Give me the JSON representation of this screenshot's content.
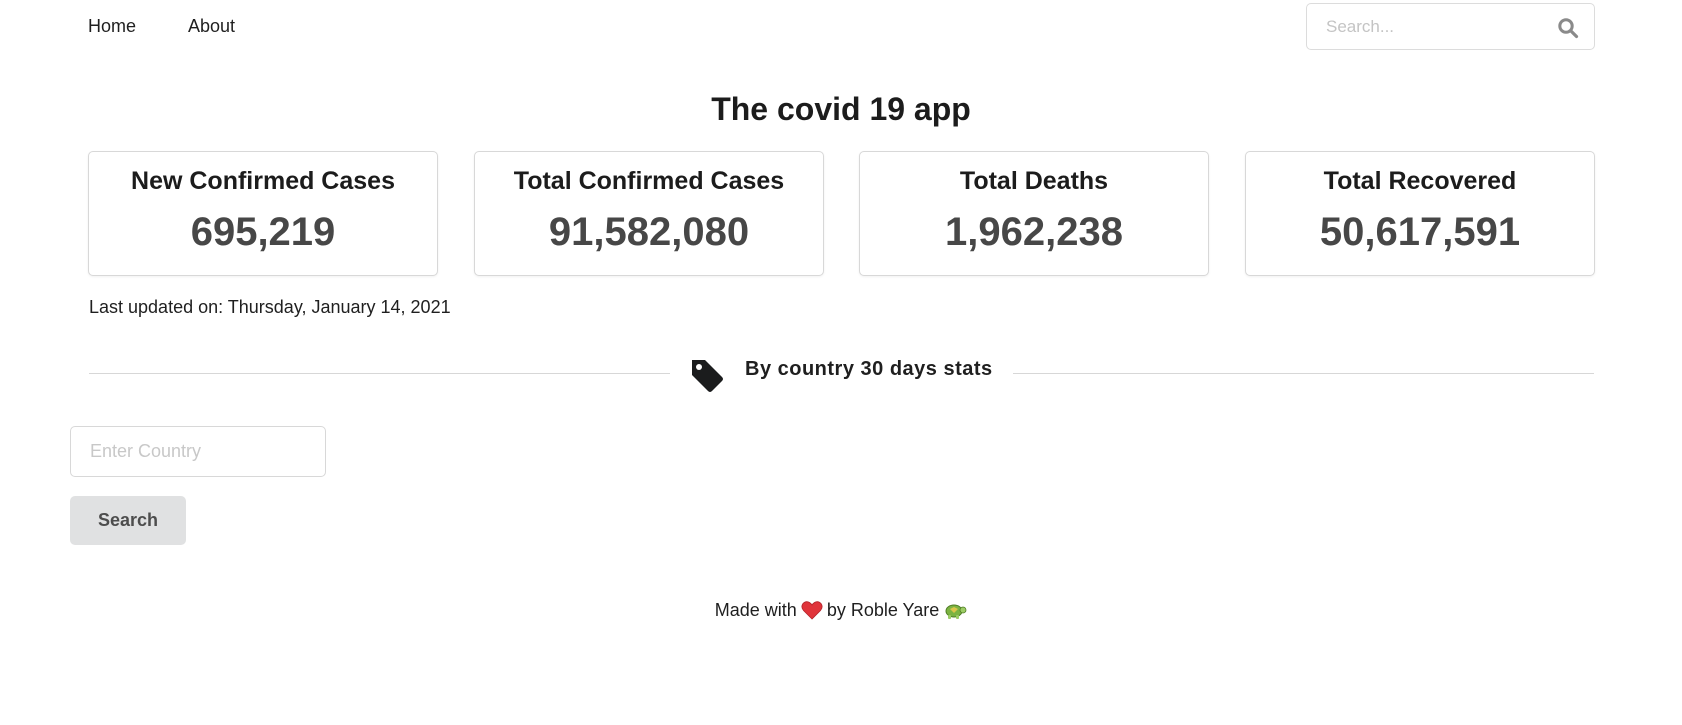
{
  "nav": {
    "home_label": "Home",
    "about_label": "About",
    "search_placeholder": "Search...",
    "search_icon": "search-icon"
  },
  "page": {
    "title": "The covid 19 app"
  },
  "stats": [
    {
      "label": "New Confirmed Cases",
      "value": "695,219"
    },
    {
      "label": "Total Confirmed Cases",
      "value": "91,582,080"
    },
    {
      "label": "Total Deaths",
      "value": "1,962,238"
    },
    {
      "label": "Total Recovered",
      "value": "50,617,591"
    }
  ],
  "last_updated": "Last updated on: Thursday, January 14, 2021",
  "section_divider": {
    "icon": "tag-icon",
    "text": "By country 30 days stats"
  },
  "country_search": {
    "placeholder": "Enter Country",
    "button_label": "Search"
  },
  "footer": {
    "made_with": "Made with",
    "by_text": "by Roble Yare",
    "heart_icon": "heart-icon",
    "turtle_icon": "turtle-icon"
  },
  "colors": {
    "text": "#1f1f1f",
    "stat_value": "#474747",
    "button_bg": "#e0e1e2",
    "border": "#d8d8d8",
    "heart": "#e0343b",
    "turtle": "#7cb342"
  }
}
